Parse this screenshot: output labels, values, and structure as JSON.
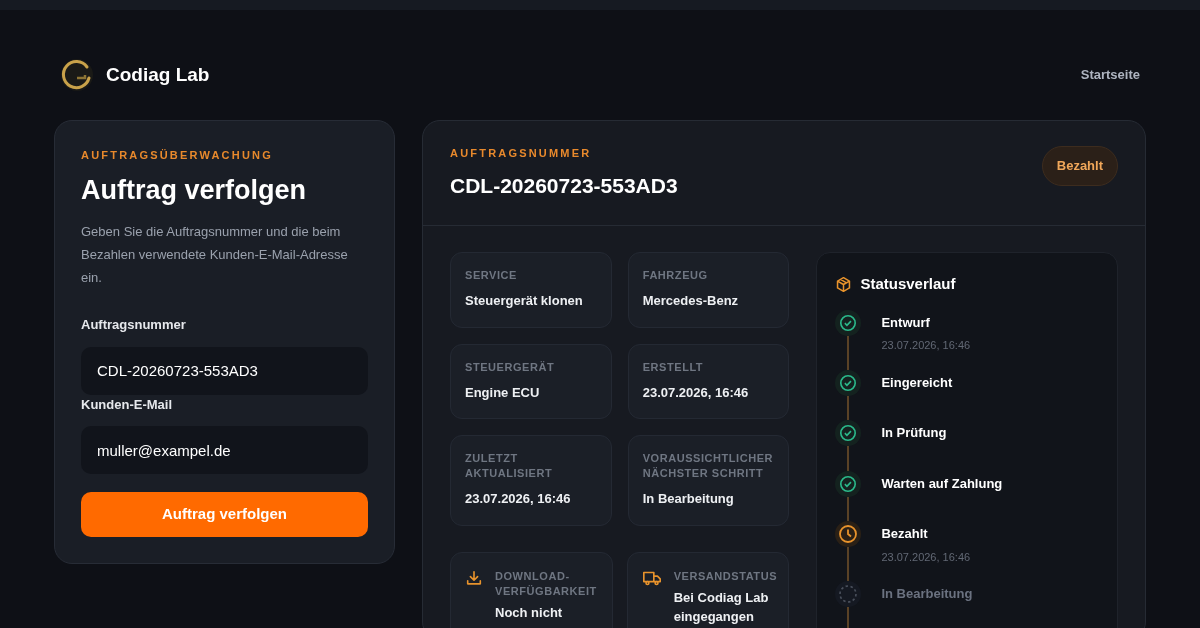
{
  "brand": {
    "name": "Codiag Lab"
  },
  "nav": [
    {
      "label": "Startseite"
    }
  ],
  "form": {
    "eyebrow": "AUFTRAGSÜBERWACHUNG",
    "title": "Auftrag verfolgen",
    "description": "Geben Sie die Auftragsnummer und die beim Bezahlen verwendete Kunden-E-Mail-Adresse ein.",
    "fields": [
      {
        "label": "Auftragsnummer",
        "value": "CDL-20260723-553AD3"
      },
      {
        "label": "Kunden-E-Mail",
        "value": "muller@exampel.de"
      }
    ],
    "submit": "Auftrag verfolgen"
  },
  "order": {
    "eyebrow": "AUFTRAGSNUMMER",
    "number": "CDL-20260723-553AD3",
    "badge": "Bezahlt",
    "details": [
      {
        "label": "SERVICE",
        "value": "Steuergerät klonen"
      },
      {
        "label": "FAHRZEUG",
        "value": "Mercedes-Benz"
      },
      {
        "label": "STEUERGERÄT",
        "value": "Engine ECU"
      },
      {
        "label": "ERSTELLT",
        "value": "23.07.2026, 16:46"
      },
      {
        "label": "ZULETZT AKTUALISIERT",
        "value": "23.07.2026, 16:46"
      },
      {
        "label": "VORAUSSICHTLICHER NÄCHSTER SCHRITT",
        "value": "In Bearbeitung"
      }
    ],
    "extras": [
      {
        "kind": "download",
        "label": "DOWNLOAD-VERFÜGBARKEIT",
        "value": "Noch nicht"
      },
      {
        "kind": "shipping",
        "label": "VERSANDSTATUS",
        "value": "Bei Codiag Lab eingegangen"
      }
    ],
    "timeline": {
      "title": "Statusverlauf",
      "steps": [
        {
          "label": "Entwurf",
          "time": "23.07.2026, 16:46",
          "kind": "done"
        },
        {
          "label": "Eingereicht",
          "kind": "done"
        },
        {
          "label": "In Prüfung",
          "kind": "done"
        },
        {
          "label": "Warten auf Zahlung",
          "kind": "done"
        },
        {
          "label": "Bezahlt",
          "time": "23.07.2026, 16:46",
          "kind": "current"
        },
        {
          "label": "In Bearbeitung",
          "kind": "pending"
        }
      ]
    }
  }
}
